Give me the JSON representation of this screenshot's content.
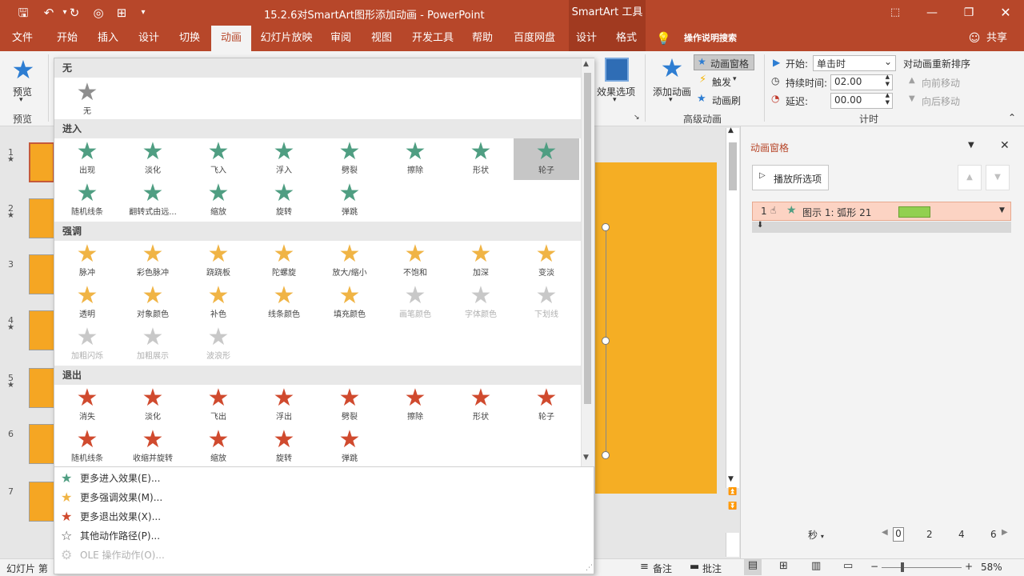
{
  "window": {
    "title": "15.2.6对SmartArt图形添加动画 - PowerPoint",
    "context_title": "SmartArt 工具",
    "qat": [
      "save-icon",
      "undo-icon",
      "redo-icon",
      "present-icon",
      "screenshot-icon",
      "more-icon"
    ]
  },
  "tabs": [
    {
      "label": "文件"
    },
    {
      "label": "开始"
    },
    {
      "label": "插入"
    },
    {
      "label": "设计"
    },
    {
      "label": "切换"
    },
    {
      "label": "动画"
    },
    {
      "label": "幻灯片放映"
    },
    {
      "label": "审阅"
    },
    {
      "label": "视图"
    },
    {
      "label": "开发工具"
    },
    {
      "label": "帮助"
    },
    {
      "label": "百度网盘"
    },
    {
      "label": "设计"
    },
    {
      "label": "格式"
    }
  ],
  "tell_me": "操作说明搜索",
  "share": "共享",
  "ribbon": {
    "preview": "预览",
    "preview_group": "预览",
    "effect_options": "效果选项",
    "add_animation": "添加动画",
    "anim_pane": "动画窗格",
    "trigger": "触发",
    "anim_painter": "动画刷",
    "advanced_group": "高级动画",
    "start_label": "开始:",
    "start_value": "单击时",
    "duration_label": "持续时间:",
    "duration_value": "02.00",
    "delay_label": "延迟:",
    "delay_value": "00.00",
    "reorder": "对动画重新排序",
    "move_earlier": "向前移动",
    "move_later": "向后移动",
    "timing_group": "计时"
  },
  "gallery": {
    "none_header": "无",
    "none_item": "无",
    "entrance_header": "进入",
    "entrance": [
      "出现",
      "淡化",
      "飞入",
      "浮入",
      "劈裂",
      "擦除",
      "形状",
      "轮子",
      "随机线条",
      "翻转式由远...",
      "缩放",
      "旋转",
      "弹跳"
    ],
    "emphasis_header": "强调",
    "emphasis": [
      "脉冲",
      "彩色脉冲",
      "跷跷板",
      "陀螺旋",
      "放大/缩小",
      "不饱和",
      "加深",
      "变淡",
      "透明",
      "对象颜色",
      "补色",
      "线条颜色",
      "填充颜色",
      "画笔颜色",
      "字体颜色",
      "下划线",
      "加粗闪烁",
      "加粗展示",
      "波浪形"
    ],
    "exit_header": "退出",
    "exit": [
      "消失",
      "淡化",
      "飞出",
      "浮出",
      "劈裂",
      "擦除",
      "形状",
      "轮子",
      "随机线条",
      "收缩并旋转",
      "缩放",
      "旋转",
      "弹跳"
    ],
    "more": [
      {
        "label": "更多进入效果(E)...",
        "icon": "green-star-icon"
      },
      {
        "label": "更多强调效果(M)...",
        "icon": "yellow-star-icon"
      },
      {
        "label": "更多退出效果(X)...",
        "icon": "red-star-icon"
      },
      {
        "label": "其他动作路径(P)...",
        "icon": "outline-star-icon"
      },
      {
        "label": "OLE 操作动作(O)...",
        "icon": "gear-icon"
      }
    ]
  },
  "slides": [
    "1",
    "2",
    "3",
    "4",
    "5",
    "6",
    "7"
  ],
  "anim_pane": {
    "title": "动画窗格",
    "play_button": "播放所选项",
    "item_number": "1",
    "item_label": "图示 1: 弧形 21",
    "seconds_label": "秒",
    "ruler": [
      "0",
      "2",
      "4",
      "6"
    ]
  },
  "status": {
    "slide": "幻灯片 第",
    "notes": "备注",
    "comments": "批注",
    "zoom": "58%"
  },
  "colors": {
    "accent": "#b7472a",
    "entrance": "#4f9e82",
    "emphasis": "#f0b445",
    "exit": "#d04a2e",
    "slide_fill": "#f5ae24"
  }
}
